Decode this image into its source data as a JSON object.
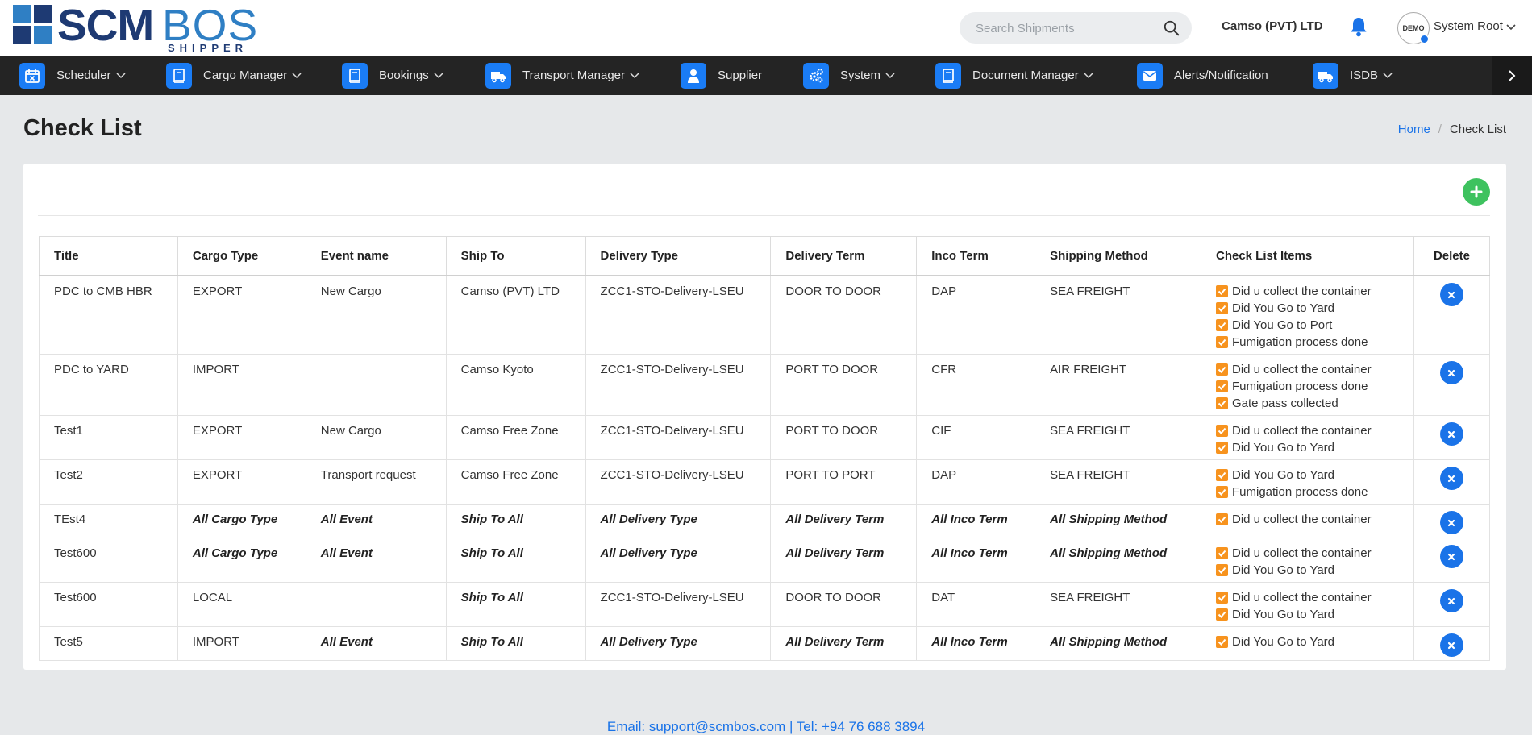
{
  "brand": {
    "name_primary": "SCM",
    "name_secondary": "BOS",
    "tagline": "SHIPPER"
  },
  "header": {
    "search_placeholder": "Search Shipments",
    "company": "Camso (PVT) LTD",
    "avatar_text": "DEMO",
    "user_name": "System Root"
  },
  "nav": [
    {
      "label": "Scheduler",
      "icon": "calendar-icon",
      "chevron": true
    },
    {
      "label": "Cargo Manager",
      "icon": "book-icon",
      "chevron": true
    },
    {
      "label": "Bookings",
      "icon": "book-icon",
      "chevron": true
    },
    {
      "label": "Transport Manager",
      "icon": "truck-icon",
      "chevron": true
    },
    {
      "label": "Supplier",
      "icon": "user-icon",
      "chevron": false
    },
    {
      "label": "System",
      "icon": "gears-icon",
      "chevron": true
    },
    {
      "label": "Document Manager",
      "icon": "book-icon",
      "chevron": true
    },
    {
      "label": "Alerts/Notification",
      "icon": "envelope-icon",
      "chevron": false
    },
    {
      "label": "ISDB",
      "icon": "truck-icon",
      "chevron": true
    }
  ],
  "page": {
    "title": "Check List",
    "breadcrumb_home": "Home",
    "breadcrumb_current": "Check List"
  },
  "table": {
    "columns": [
      "Title",
      "Cargo Type",
      "Event name",
      "Ship To",
      "Delivery Type",
      "Delivery Term",
      "Inco Term",
      "Shipping Method",
      "Check List Items",
      "Delete"
    ],
    "rows": [
      {
        "title": "PDC to CMB HBR",
        "cargo_type": "EXPORT",
        "event": "New Cargo",
        "ship_to": "Camso (PVT) LTD",
        "delivery_type": "ZCC1-STO-Delivery-LSEU",
        "delivery_term": "DOOR TO DOOR",
        "inco_term": "DAP",
        "shipping_method": "SEA FREIGHT",
        "items": [
          "Did u collect the container",
          "Did You Go to Yard",
          "Did You Go to Port",
          "Fumigation process done"
        ]
      },
      {
        "title": "PDC to YARD",
        "cargo_type": "IMPORT",
        "event": "",
        "ship_to": "Camso Kyoto",
        "delivery_type": "ZCC1-STO-Delivery-LSEU",
        "delivery_term": "PORT TO DOOR",
        "inco_term": "CFR",
        "shipping_method": "AIR FREIGHT",
        "items": [
          "Did u collect the container",
          "Fumigation process done",
          "Gate pass collected"
        ]
      },
      {
        "title": "Test1",
        "cargo_type": "EXPORT",
        "event": "New Cargo",
        "ship_to": "Camso Free Zone",
        "delivery_type": "ZCC1-STO-Delivery-LSEU",
        "delivery_term": "PORT TO DOOR",
        "inco_term": "CIF",
        "shipping_method": "SEA FREIGHT",
        "items": [
          "Did u collect the container",
          "Did You Go to Yard"
        ]
      },
      {
        "title": "Test2",
        "cargo_type": "EXPORT",
        "event": "Transport request",
        "ship_to": "Camso Free Zone",
        "delivery_type": "ZCC1-STO-Delivery-LSEU",
        "delivery_term": "PORT TO PORT",
        "inco_term": "DAP",
        "shipping_method": "SEA FREIGHT",
        "items": [
          "Did You Go to Yard",
          "Fumigation process done"
        ]
      },
      {
        "title": "TEst4",
        "cargo_type": "All Cargo Type",
        "event": "All Event",
        "ship_to": "Ship To All",
        "delivery_type": "All Delivery Type",
        "delivery_term": "All Delivery Term",
        "inco_term": "All Inco Term",
        "shipping_method": "All Shipping Method",
        "all_fields": [
          "cargo_type",
          "event",
          "ship_to",
          "delivery_type",
          "delivery_term",
          "inco_term",
          "shipping_method"
        ],
        "items": [
          "Did u collect the container"
        ]
      },
      {
        "title": "Test600",
        "cargo_type": "All Cargo Type",
        "event": "All Event",
        "ship_to": "Ship To All",
        "delivery_type": "All Delivery Type",
        "delivery_term": "All Delivery Term",
        "inco_term": "All Inco Term",
        "shipping_method": "All Shipping Method",
        "all_fields": [
          "cargo_type",
          "event",
          "ship_to",
          "delivery_type",
          "delivery_term",
          "inco_term",
          "shipping_method"
        ],
        "items": [
          "Did u collect the container",
          "Did You Go to Yard"
        ]
      },
      {
        "title": "Test600",
        "cargo_type": "LOCAL",
        "event": "",
        "ship_to": "Ship To All",
        "delivery_type": "ZCC1-STO-Delivery-LSEU",
        "delivery_term": "DOOR TO DOOR",
        "inco_term": "DAT",
        "shipping_method": "SEA FREIGHT",
        "all_fields": [
          "ship_to"
        ],
        "items": [
          "Did u collect the container",
          "Did You Go to Yard"
        ]
      },
      {
        "title": "Test5",
        "cargo_type": "IMPORT",
        "event": "All Event",
        "ship_to": "Ship To All",
        "delivery_type": "All Delivery Type",
        "delivery_term": "All Delivery Term",
        "inco_term": "All Inco Term",
        "shipping_method": "All Shipping Method",
        "all_fields": [
          "event",
          "ship_to",
          "delivery_type",
          "delivery_term",
          "inco_term",
          "shipping_method"
        ],
        "items": [
          "Did You Go to Yard"
        ]
      }
    ]
  },
  "footer": {
    "text": "Email: support@scmbos.com | Tel: +94 76 688 3894"
  },
  "colors": {
    "nav_bg": "#242424",
    "accent": "#1a73e8",
    "add_green": "#3ec25f",
    "checkbox_orange": "#f7931e",
    "logo_navy": "#1e3a73",
    "logo_blue": "#2f7fc4"
  }
}
